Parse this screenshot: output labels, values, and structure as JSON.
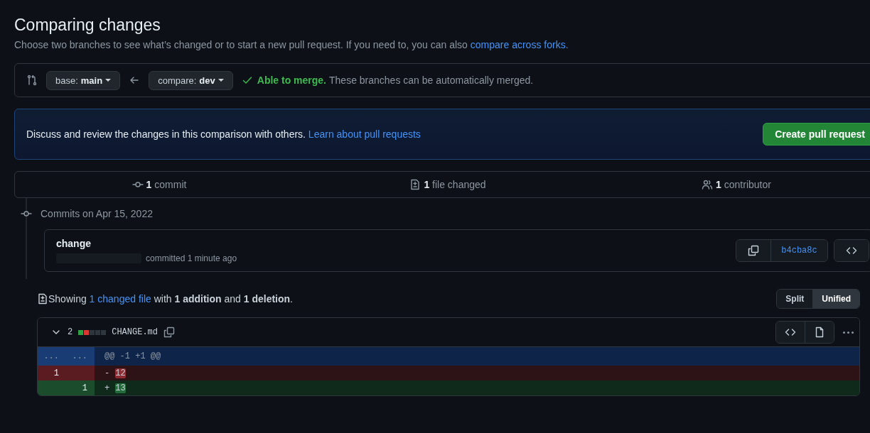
{
  "header": {
    "title": "Comparing changes",
    "description": "Choose two branches to see what’s changed or to start a new pull request. If you need to, you can also",
    "link": "compare across forks."
  },
  "range": {
    "base_label": "base:",
    "base": "main",
    "compare_label": "compare:",
    "compare": "dev",
    "merge_status": "Able to merge.",
    "merge_note": "These branches can be automatically merged."
  },
  "banner": {
    "text": "Discuss and review the changes in this comparison with others.",
    "link": "Learn about pull requests",
    "button": "Create pull request"
  },
  "summary": [
    {
      "kind": "commit",
      "count": "1",
      "label": "commit"
    },
    {
      "kind": "file",
      "count": "1",
      "label": "file changed"
    },
    {
      "kind": "people",
      "count": "1",
      "label": "contributor"
    }
  ],
  "commits": {
    "date": "Commits on Apr 15, 2022",
    "items": [
      {
        "title": "change",
        "meta": "committed 1 minute ago",
        "sha": "b4cba8c"
      }
    ]
  },
  "files_summary": {
    "text": "Showing",
    "link": "1 changed file",
    "rest": "with **1 addition** and **1 deletion**.",
    "views": [
      {
        "label": "Split",
        "selected": false
      },
      {
        "label": "Unified",
        "selected": true
      }
    ]
  },
  "file": {
    "count": "2",
    "stat": [
      {
        "kind": "added"
      },
      {
        "kind": "deleted"
      },
      {
        "kind": "neutral"
      },
      {
        "kind": "neutral"
      },
      {
        "kind": "neutral"
      }
    ],
    "name": "CHANGE.md",
    "expanded": true,
    "lines": [
      {
        "kind": "hunk",
        "old": "...",
        "new": "...",
        "text": "@@ -1 +1 @@"
      },
      {
        "kind": "deletion",
        "old": "1",
        "sign": "-",
        "text": "12"
      },
      {
        "kind": "addition",
        "new": "1",
        "sign": "+",
        "text": "13"
      }
    ]
  }
}
